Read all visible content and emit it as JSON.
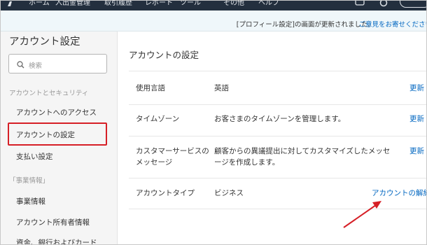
{
  "topbar": {
    "nav": [
      "ホーム",
      "入出金管理",
      "取引履歴",
      "レポート",
      "ツール",
      "その他",
      "ヘルプ"
    ]
  },
  "notice": {
    "message": "[プロフィール設定]の画面が更新されました。",
    "link": "ご意見をお寄せください"
  },
  "sidebar": {
    "title": "アカウント設定",
    "search_placeholder": "検索",
    "section1": "アカウントとセキュリティ",
    "items1": [
      "アカウントへのアクセス",
      "アカウントの設定",
      "支払い設定"
    ],
    "section2": "「事業情報」",
    "items2": [
      "事業情報",
      "アカウント所有者情報",
      "資金、銀行およびカード"
    ]
  },
  "main": {
    "heading": "アカウントの設定",
    "rows": [
      {
        "label": "使用言語",
        "value": "英語",
        "action": "更新"
      },
      {
        "label": "タイムゾーン",
        "value": "お客さまのタイムゾーンを管理します。",
        "action": "更新"
      },
      {
        "label": "カスタマーサービスの",
        "label2": "メッセージ",
        "value": "顧客からの異議提出に対してカスタマイズしたメッセ",
        "value2": "ージを作成します。",
        "action": "更新"
      },
      {
        "label": "アカウントタイプ",
        "value": "ビジネス",
        "action": "アカウントの解約"
      }
    ]
  },
  "colors": {
    "topbar": "#232f3e",
    "link": "#0066c0",
    "highlight": "#d61f26",
    "arrow": "#d61f26"
  }
}
